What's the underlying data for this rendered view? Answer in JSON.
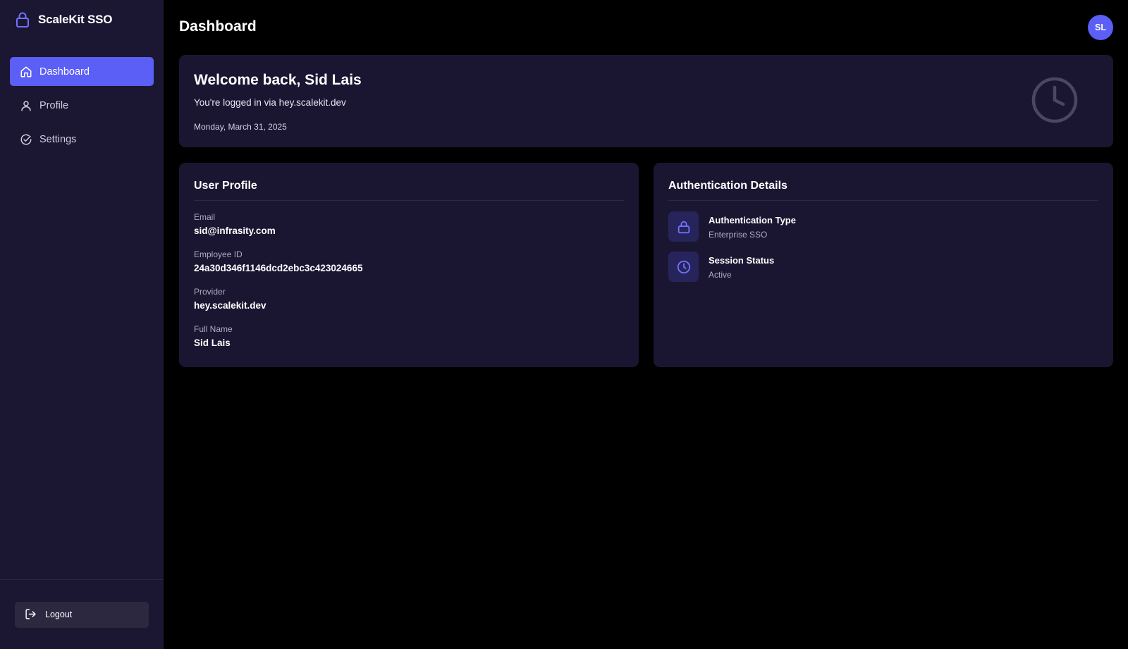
{
  "app": {
    "brand": "ScaleKit SSO",
    "brand_icon": "lock-icon",
    "accent": "#5b5ff5"
  },
  "sidebar": {
    "items": [
      {
        "label": "Dashboard",
        "icon": "home-icon",
        "active": true
      },
      {
        "label": "Profile",
        "icon": "user-icon",
        "active": false
      },
      {
        "label": "Settings",
        "icon": "check-circle-icon",
        "active": false
      }
    ],
    "logout_label": "Logout",
    "logout_icon": "logout-icon"
  },
  "header": {
    "title": "Dashboard",
    "avatar_initials": "SL"
  },
  "welcome": {
    "title": "Welcome back, Sid Lais",
    "subtitle": "You're logged in via hey.scalekit.dev",
    "date": "Monday, March 31, 2025",
    "icon": "clock-icon"
  },
  "user_profile": {
    "title": "User Profile",
    "fields": [
      {
        "label": "Email",
        "value": "sid@infrasity.com"
      },
      {
        "label": "Employee ID",
        "value": "24a30d346f1146dcd2ebc3c423024665"
      },
      {
        "label": "Provider",
        "value": "hey.scalekit.dev"
      },
      {
        "label": "Full Name",
        "value": "Sid Lais"
      }
    ]
  },
  "auth_details": {
    "title": "Authentication Details",
    "items": [
      {
        "title": "Authentication Type",
        "value": "Enterprise SSO",
        "icon": "lock-icon"
      },
      {
        "title": "Session Status",
        "value": "Active",
        "icon": "clock-icon"
      }
    ]
  }
}
